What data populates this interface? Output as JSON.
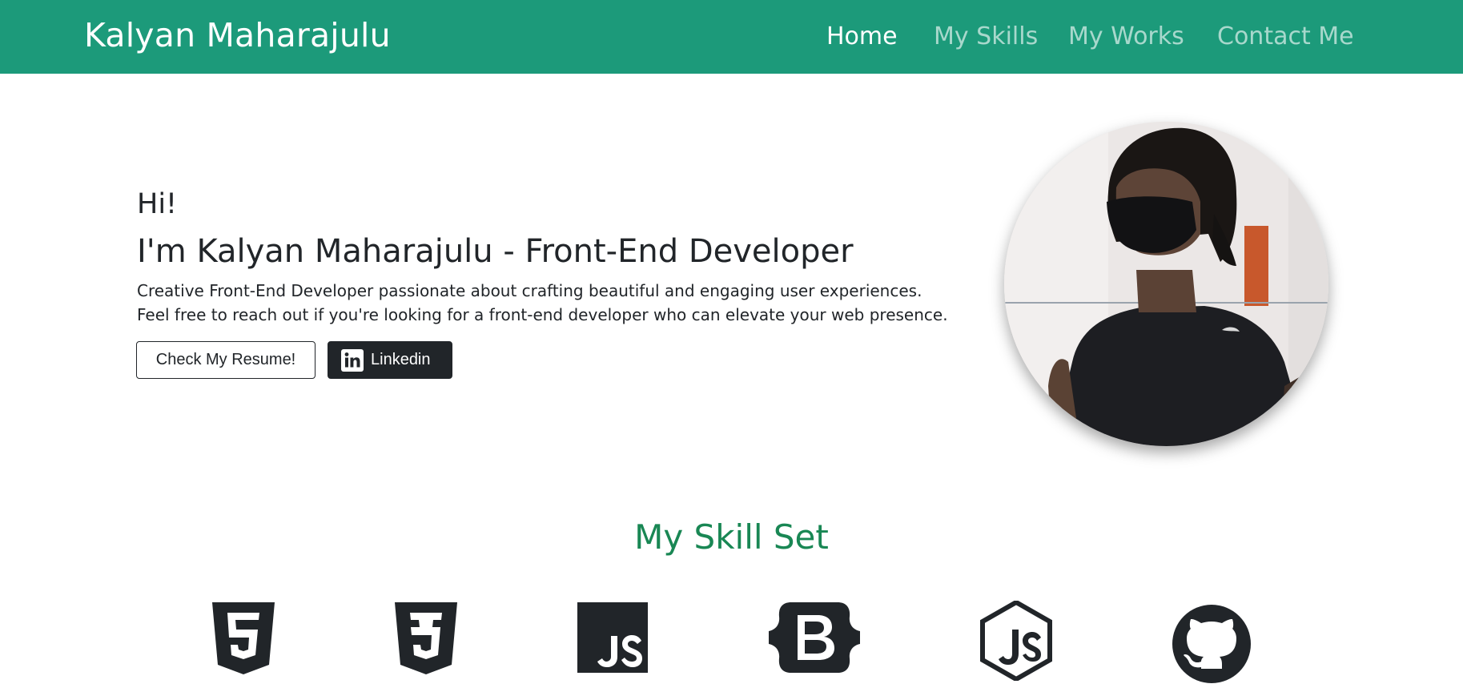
{
  "navbar": {
    "brand": "Kalyan Maharajulu",
    "links": [
      "Home",
      "My Skills",
      "My Works",
      "Contact Me"
    ]
  },
  "hero": {
    "greeting": "Hi!",
    "title": "I'm Kalyan Maharajulu - Front-End Developer",
    "description_line1": "Creative Front-End Developer passionate about crafting beautiful and engaging user experiences.",
    "description_line2": "Feel free to reach out if you're looking for a front-end developer who can elevate your web presence.",
    "resume_button": "Check My Resume!",
    "linkedin_button": "Linkedin"
  },
  "skills": {
    "heading": "My Skill Set",
    "icons": [
      "html5-icon",
      "css3-icon",
      "javascript-icon",
      "bootstrap-icon",
      "nodejs-icon",
      "github-icon"
    ]
  },
  "colors": {
    "navbar_bg": "#1c9a7a",
    "heading_green": "#198754",
    "dark": "#212529"
  }
}
